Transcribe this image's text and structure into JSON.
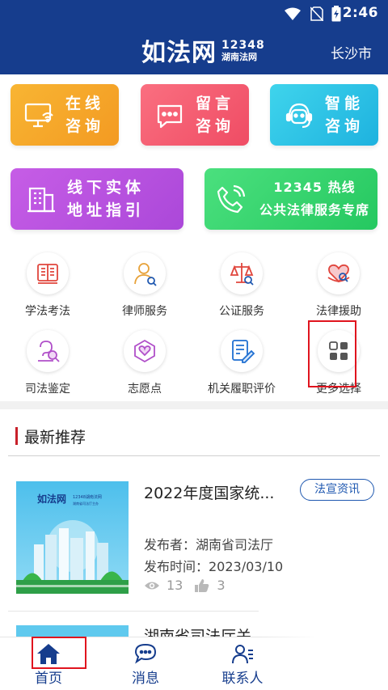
{
  "status_bar": {
    "time": "2:46"
  },
  "header": {
    "brand_main": "如法网",
    "brand_number": "12348",
    "brand_sub": "湖南法网",
    "city": "长沙市"
  },
  "tiles": [
    {
      "line1": "在线",
      "line2": "咨询",
      "icon": "computer-wifi-icon",
      "color": "#f5a72a"
    },
    {
      "line1": "留言",
      "line2": "咨询",
      "icon": "chat-bubble-icon",
      "color": "#f55e74"
    },
    {
      "line1": "智能",
      "line2": "咨询",
      "icon": "robot-headset-icon",
      "color": "#2dc3e6"
    },
    {
      "line1": "线下实体",
      "line2": "地址指引",
      "icon": "building-icon",
      "color": "#b851df"
    },
    {
      "line1": "12345 热线",
      "line2": "公共法律服务专席",
      "icon": "phone-icon",
      "color": "#34d26c"
    }
  ],
  "services": [
    {
      "label": "学法考法",
      "icon": "book-icon"
    },
    {
      "label": "律师服务",
      "icon": "lawyer-icon"
    },
    {
      "label": "公证服务",
      "icon": "scales-icon"
    },
    {
      "label": "法律援助",
      "icon": "heart-hands-icon"
    },
    {
      "label": "司法鉴定",
      "icon": "appraisal-icon"
    },
    {
      "label": "志愿点",
      "icon": "volunteer-icon"
    },
    {
      "label": "机关履职评价",
      "icon": "document-edit-icon"
    },
    {
      "label": "更多选择",
      "icon": "grid-icon"
    }
  ],
  "section": {
    "title": "最新推荐"
  },
  "news": {
    "title": "2022年度国家统...",
    "tag": "法宣资讯",
    "publisher": "发布者：湖南省司法厅",
    "date": "发布时间：2023/03/10",
    "views": "13",
    "likes": "3",
    "thumb_brand": "如法网",
    "thumb_sub1": "12348湖南法网",
    "thumb_sub2": "湖南省司法厅主办"
  },
  "next_news": {
    "title": "湖南省司法厅关"
  },
  "tabbar": {
    "home": "首页",
    "messages": "消息",
    "contacts": "联系人"
  },
  "colors": {
    "header_bg": "#163d8d",
    "accent_red": "#e0141e",
    "tag_blue": "#1f58b0"
  }
}
